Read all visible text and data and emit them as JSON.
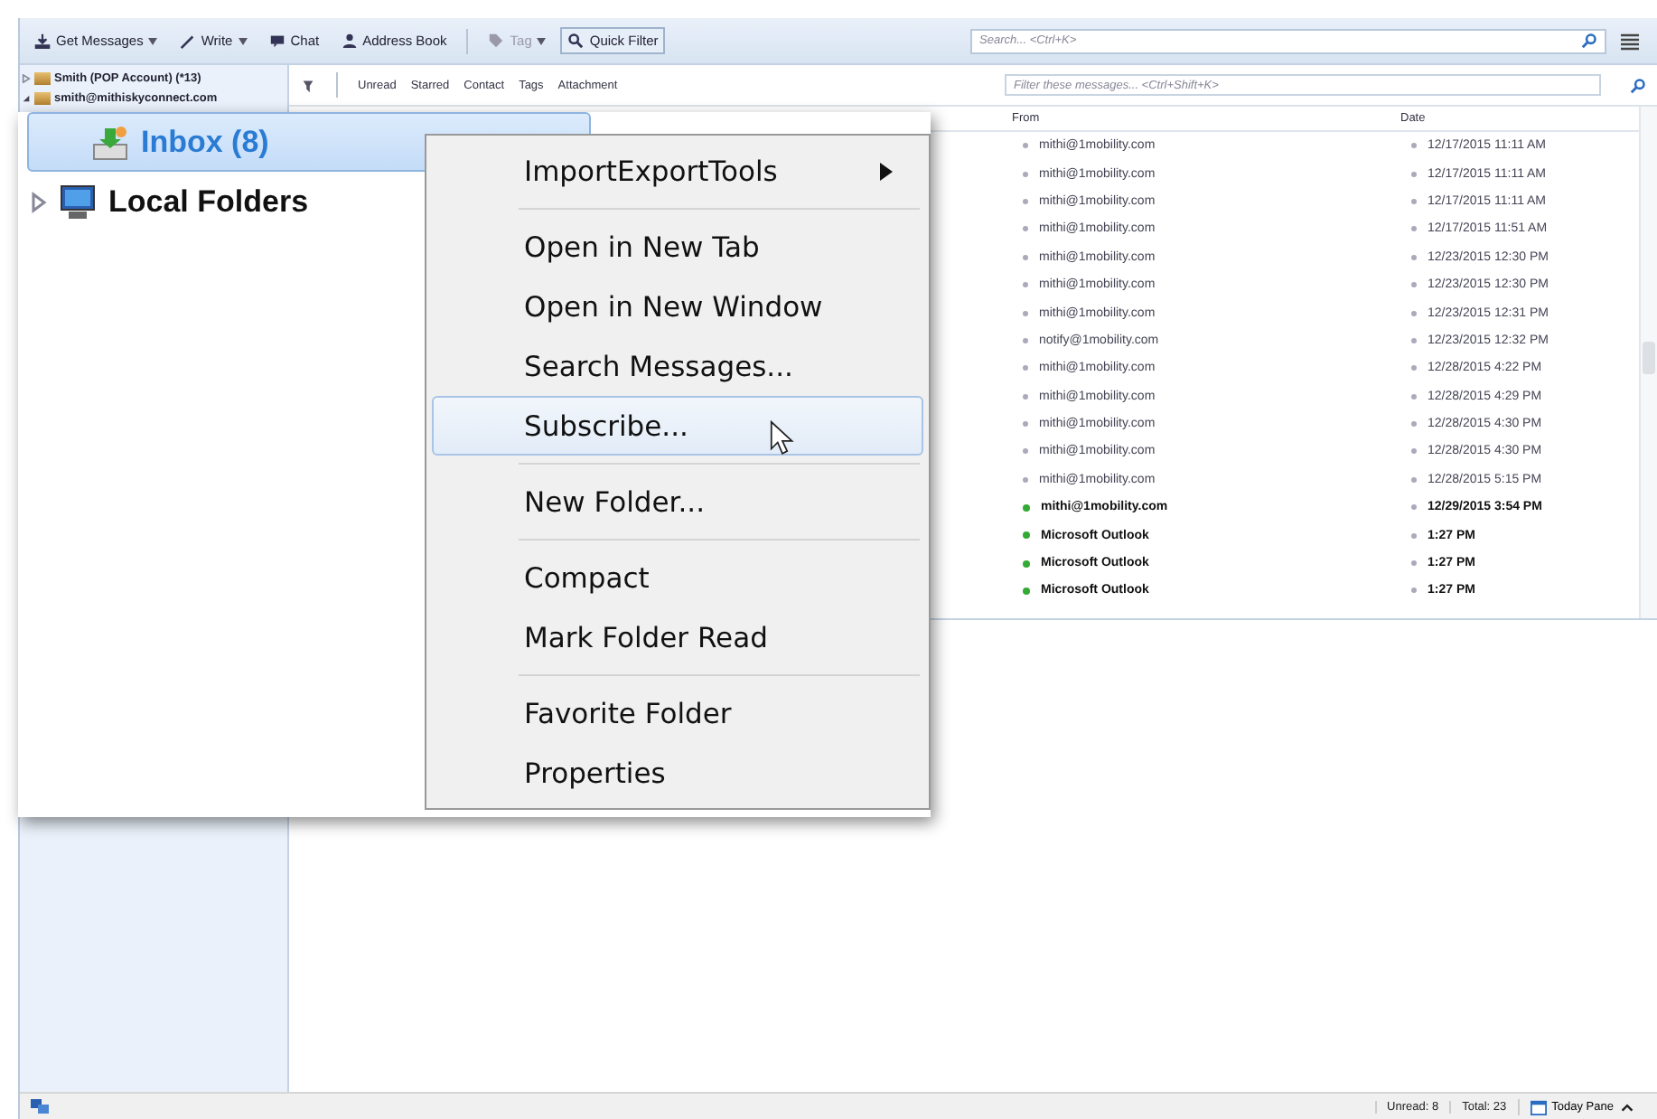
{
  "toolbar": {
    "buttons": [
      {
        "kind": "split",
        "label": "Get Messages",
        "disabled": false,
        "pressed": false
      },
      {
        "kind": "split",
        "label": "Write",
        "disabled": false,
        "pressed": false
      },
      {
        "kind": "plain",
        "label": "Chat",
        "disabled": false,
        "pressed": false
      },
      {
        "kind": "plain",
        "label": "Address Book",
        "disabled": false,
        "pressed": false
      },
      {
        "kind": "split",
        "label": "Tag",
        "disabled": true,
        "pressed": false
      },
      {
        "kind": "plain",
        "label": "Quick Filter",
        "disabled": false,
        "pressed": true
      }
    ],
    "search": {
      "placeholder": "Search... <Ctrl+K>"
    }
  },
  "accounts": [
    {
      "label": "Smith (POP Account) (*13)",
      "expanded": false
    },
    {
      "label": "smith@mithiskyconnect.com",
      "expanded": true
    }
  ],
  "filter_bar": {
    "buttons": [
      "Unread",
      "Starred",
      "Contact",
      "Tags",
      "Attachment"
    ],
    "placeholder": "Filter these messages... <Ctrl+Shift+K>"
  },
  "columns": {
    "from": "From",
    "date": "Date"
  },
  "messages": [
    {
      "from": "mithi@1mobility.com",
      "date": "12/17/2015 11:11 AM",
      "unread": false
    },
    {
      "from": "mithi@1mobility.com",
      "date": "12/17/2015 11:11 AM",
      "unread": false
    },
    {
      "from": "mithi@1mobility.com",
      "date": "12/17/2015 11:11 AM",
      "unread": false
    },
    {
      "from": "mithi@1mobility.com",
      "date": "12/17/2015 11:51 AM",
      "unread": false
    },
    {
      "from": "mithi@1mobility.com",
      "date": "12/23/2015 12:30 PM",
      "unread": false
    },
    {
      "from": "mithi@1mobility.com",
      "date": "12/23/2015 12:30 PM",
      "unread": false
    },
    {
      "from": "mithi@1mobility.com",
      "date": "12/23/2015 12:31 PM",
      "unread": false
    },
    {
      "from": "notify@1mobility.com",
      "date": "12/23/2015 12:32 PM",
      "unread": false
    },
    {
      "from": "mithi@1mobility.com",
      "date": "12/28/2015 4:22 PM",
      "unread": false
    },
    {
      "from": "mithi@1mobility.com",
      "date": "12/28/2015 4:29 PM",
      "unread": false
    },
    {
      "from": "mithi@1mobility.com",
      "date": "12/28/2015 4:30 PM",
      "unread": false
    },
    {
      "from": "mithi@1mobility.com",
      "date": "12/28/2015 4:30 PM",
      "unread": false
    },
    {
      "from": "mithi@1mobility.com",
      "date": "12/28/2015 5:15 PM",
      "unread": false
    },
    {
      "from": "mithi@1mobility.com",
      "date": "12/29/2015 3:54 PM",
      "unread": true
    },
    {
      "from": "Microsoft Outlook",
      "date": "1:27 PM",
      "unread": true
    },
    {
      "from": "Microsoft Outlook",
      "date": "1:27 PM",
      "unread": true
    },
    {
      "from": "Microsoft Outlook",
      "date": "1:27 PM",
      "unread": true
    }
  ],
  "folders": [
    {
      "label": "Inbox (8)",
      "kind": "inbox",
      "selected": true
    },
    {
      "label": "Local Folders",
      "kind": "local",
      "selected": false,
      "expanded": false
    }
  ],
  "context_menu": [
    {
      "kind": "submenu",
      "label": "ImportExportTools",
      "selected": false
    },
    {
      "kind": "separator"
    },
    {
      "kind": "item",
      "label": "Open in New Tab",
      "selected": false
    },
    {
      "kind": "item",
      "label": "Open in New Window",
      "selected": false
    },
    {
      "kind": "item",
      "label": "Search Messages...",
      "selected": false
    },
    {
      "kind": "item",
      "label": "Subscribe...",
      "selected": true
    },
    {
      "kind": "separator"
    },
    {
      "kind": "item",
      "label": "New Folder...",
      "selected": false
    },
    {
      "kind": "separator"
    },
    {
      "kind": "item",
      "label": "Compact",
      "selected": false
    },
    {
      "kind": "item",
      "label": "Mark Folder Read",
      "selected": false
    },
    {
      "kind": "separator"
    },
    {
      "kind": "item",
      "label": "Favorite Folder",
      "selected": false
    },
    {
      "kind": "item",
      "label": "Properties",
      "selected": false
    }
  ],
  "status_bar": {
    "unread": "Unread: 8",
    "total": "Total: 23",
    "today_pane": "Today Pane"
  }
}
